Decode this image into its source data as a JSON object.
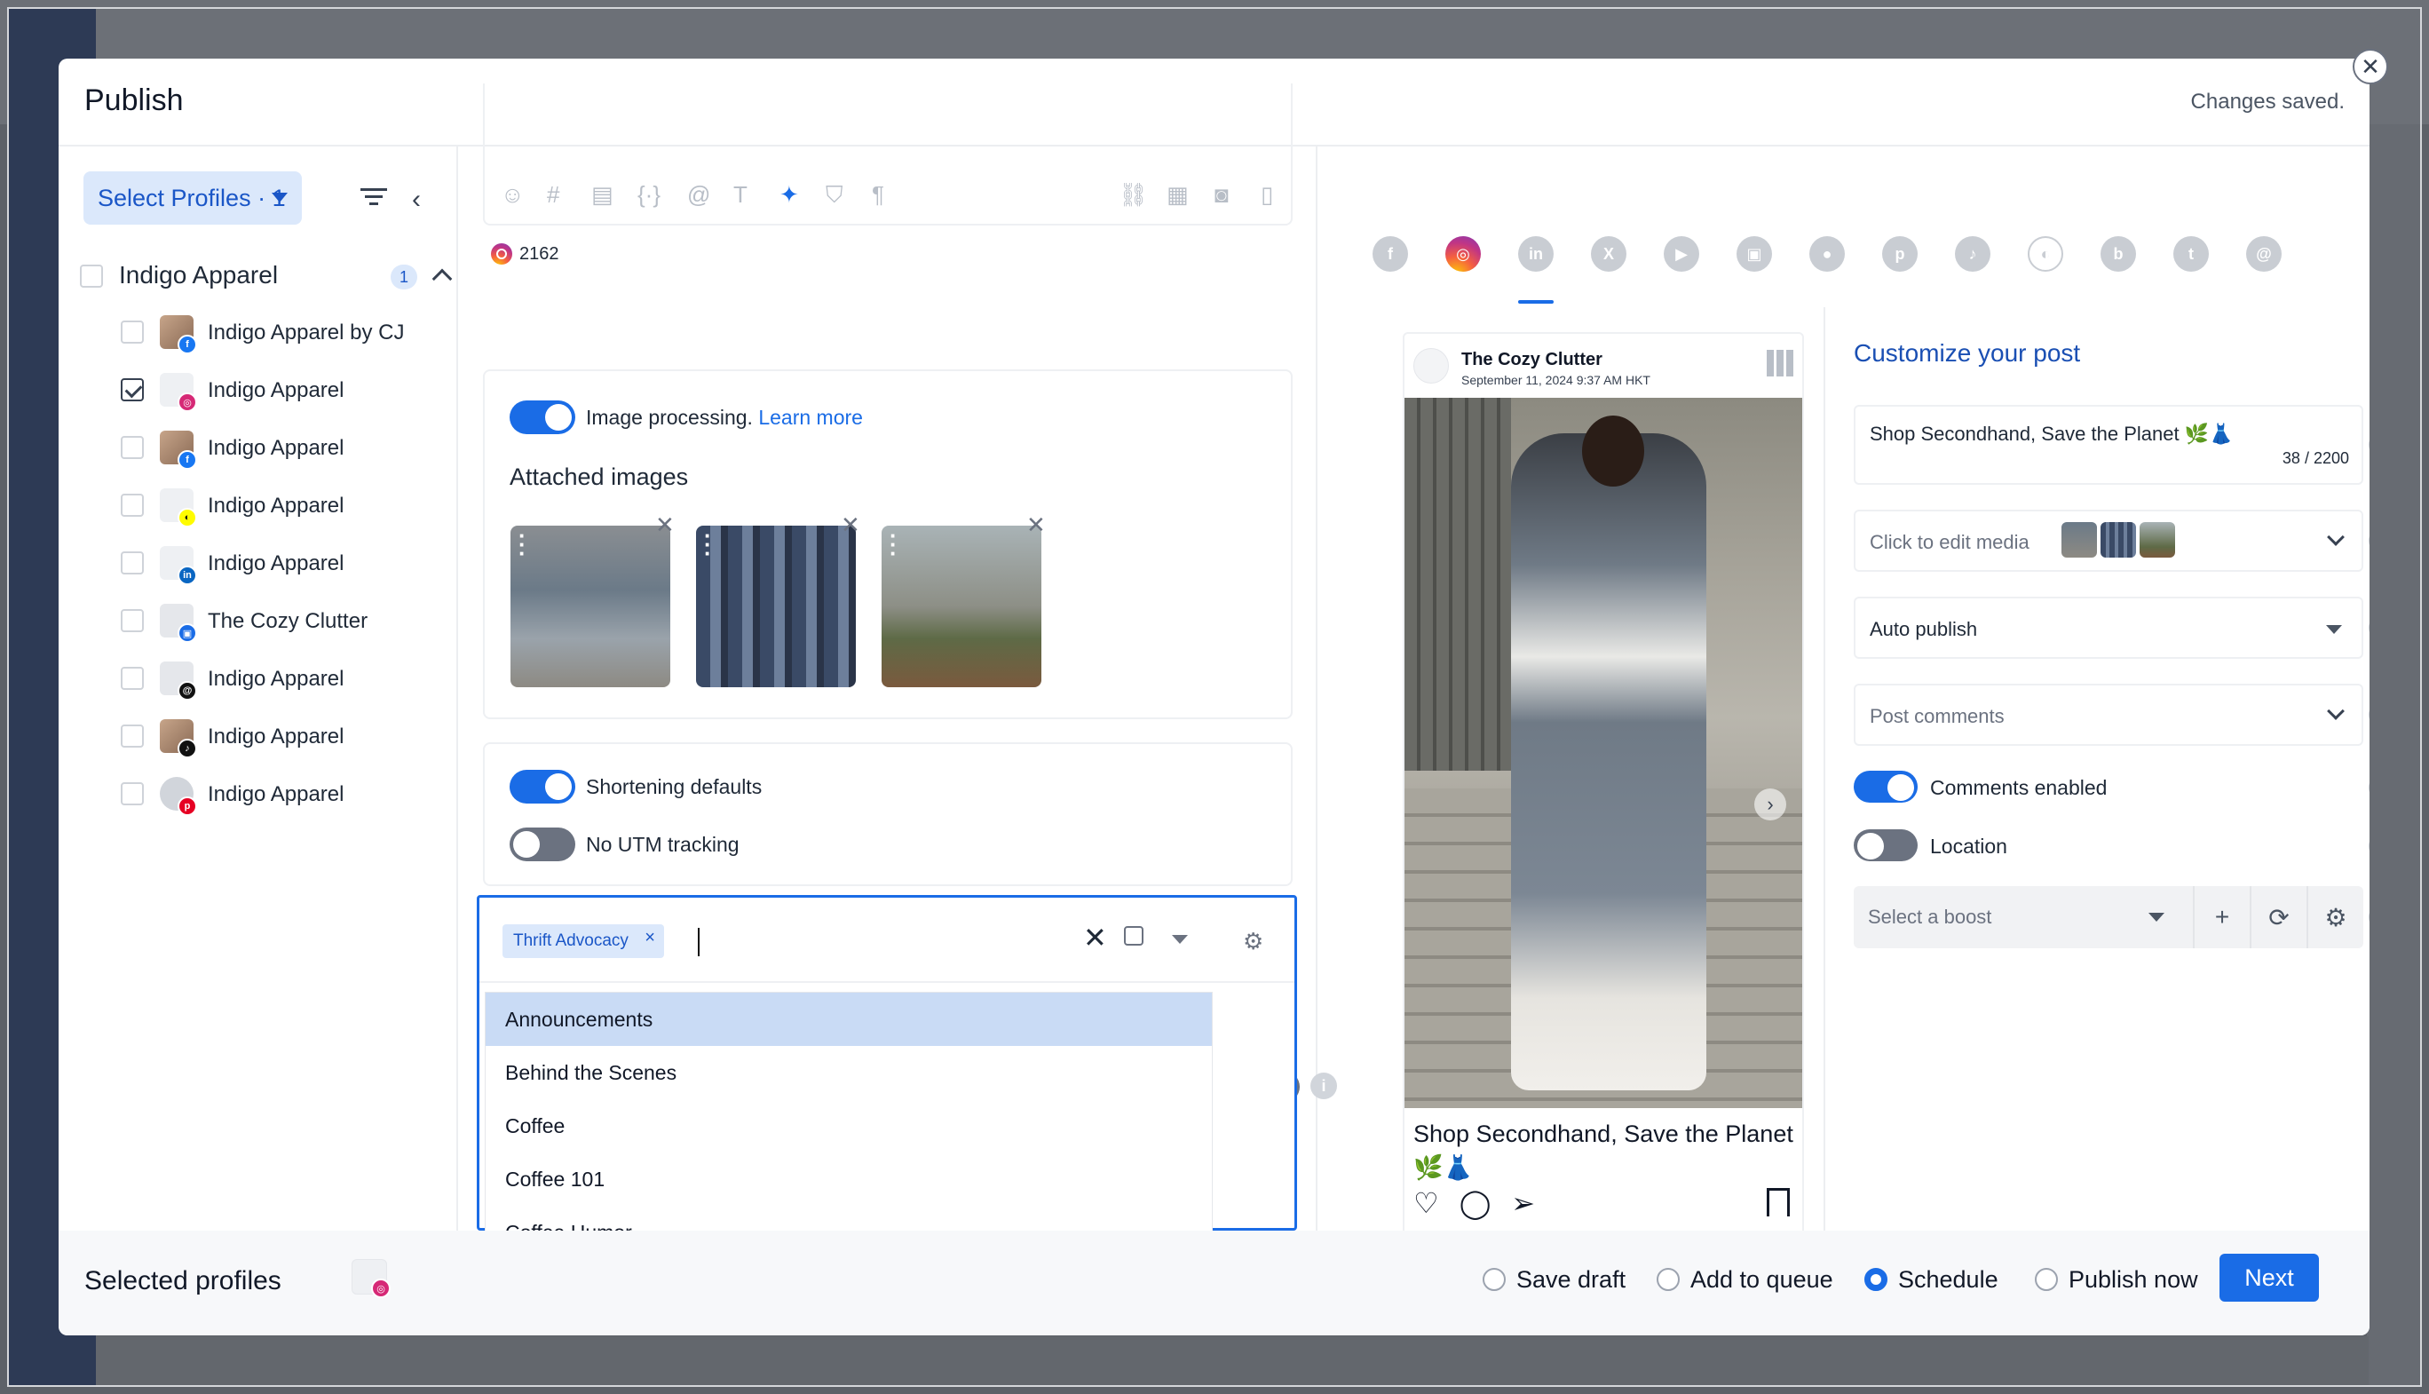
{
  "modal": {
    "title": "Publish",
    "saved_status": "Changes saved."
  },
  "sidebar": {
    "select_profiles_label": "Select Profiles · 1",
    "group": {
      "label": "Indigo Apparel",
      "count": "1"
    },
    "profiles": [
      {
        "label": "Indigo Apparel by CJ",
        "network": "facebook",
        "checked": false
      },
      {
        "label": "Indigo Apparel",
        "network": "instagram",
        "checked": true
      },
      {
        "label": "Indigo Apparel",
        "network": "facebook",
        "checked": false
      },
      {
        "label": "Indigo Apparel",
        "network": "snapchat",
        "checked": false
      },
      {
        "label": "Indigo Apparel",
        "network": "linkedin",
        "checked": false
      },
      {
        "label": "The Cozy Clutter",
        "network": "google-business",
        "checked": false
      },
      {
        "label": "Indigo Apparel",
        "network": "threads",
        "checked": false
      },
      {
        "label": "Indigo Apparel",
        "network": "tiktok",
        "checked": false
      },
      {
        "label": "Indigo Apparel",
        "network": "pinterest",
        "checked": false
      }
    ]
  },
  "editor": {
    "char_count": "2162"
  },
  "image_panel": {
    "processing_label": "Image processing.",
    "learn_more": "Learn more",
    "attached_title": "Attached images"
  },
  "shortening": {
    "shortening_label": "Shortening defaults",
    "utm_label": "No UTM tracking"
  },
  "tags": {
    "selected_chip": "Thrift Advocacy",
    "options": [
      "Announcements",
      "Behind the Scenes",
      "Coffee",
      "Coffee 101",
      "Coffee Humor"
    ]
  },
  "preview": {
    "account_name": "The Cozy Clutter",
    "timestamp": "September 11, 2024 9:37 AM HKT",
    "caption": "Shop Secondhand, Save the Planet 🌿👗"
  },
  "customize": {
    "title": "Customize your post",
    "post_text": "Shop Secondhand, Save the Planet 🌿👗",
    "post_counter": "38 / 2200",
    "media_label": "Click to edit media",
    "publish_mode": "Auto publish",
    "post_comments_placeholder": "Post comments",
    "comments_enabled_label": "Comments enabled",
    "location_label": "Location",
    "boost_placeholder": "Select a boost"
  },
  "footer": {
    "selected_profiles_label": "Selected profiles",
    "options": [
      {
        "label": "Save draft",
        "selected": false
      },
      {
        "label": "Add to queue",
        "selected": false
      },
      {
        "label": "Schedule",
        "selected": true
      },
      {
        "label": "Publish now",
        "selected": false
      }
    ],
    "next_label": "Next"
  },
  "colors": {
    "accent": "#1a6ce6",
    "title_blue": "#1a4fb3",
    "highlight": "#c9dbf5"
  }
}
